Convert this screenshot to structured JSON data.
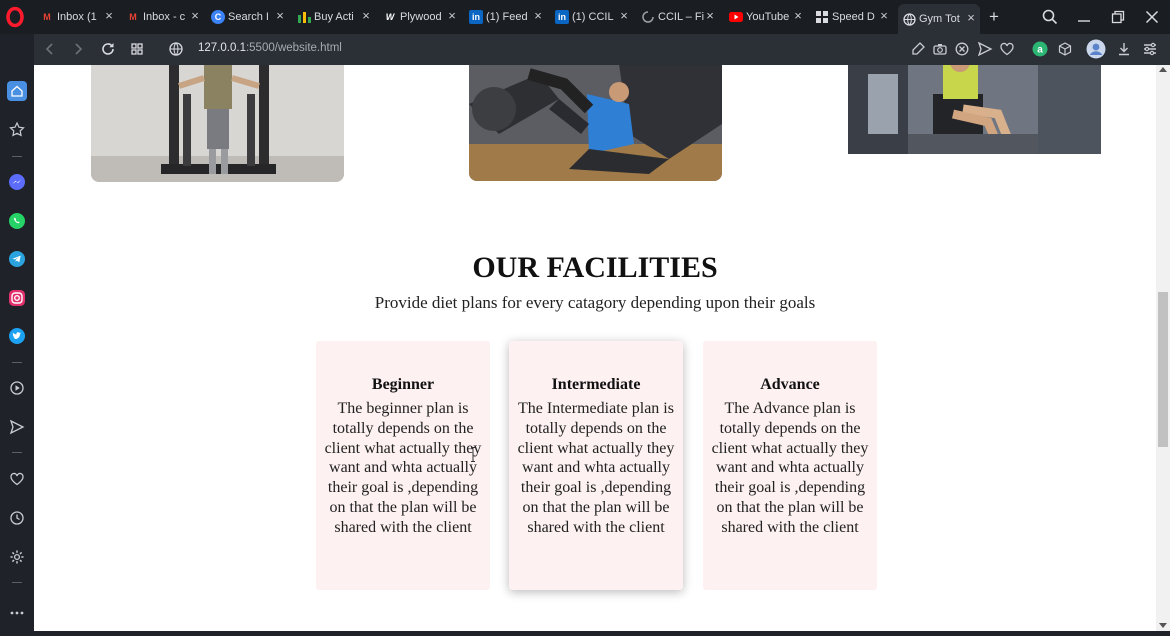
{
  "browser": {
    "tabs": [
      {
        "title": "Inbox (1",
        "icon": "gmail-icon"
      },
      {
        "title": "Inbox - c",
        "icon": "gmail-icon"
      },
      {
        "title": "Search I",
        "icon": "search-app-icon"
      },
      {
        "title": "Buy Acti",
        "icon": "bar-chart-icon"
      },
      {
        "title": "Plywood",
        "icon": "plywood-icon"
      },
      {
        "title": "(1) Feed",
        "icon": "linkedin-icon"
      },
      {
        "title": "(1) CCIL",
        "icon": "linkedin-icon"
      },
      {
        "title": "CCIL – Fi",
        "icon": "loading-icon"
      },
      {
        "title": "YouTube",
        "icon": "youtube-icon"
      },
      {
        "title": "Speed D",
        "icon": "speed-dial-icon"
      },
      {
        "title": "Gym Tot",
        "icon": "globe-icon"
      }
    ],
    "active_tab_index": 10,
    "address": {
      "host": "127.0.0.1",
      "path": ":5500/website.html"
    }
  },
  "facilities": {
    "title": "OUR FACILITIES",
    "subtitle": "Provide diet plans for every catagory depending upon their goals",
    "cards": [
      {
        "title": "Beginner",
        "text": "The beginner plan is totally depends on the client what actually they want and whta actually their goal is ,depending on that the plan will be shared with the client"
      },
      {
        "title": "Intermediate",
        "text": "The Intermediate plan is totally depends on the client what actually they want and whta actually their goal is ,depending on that the plan will be shared with the client"
      },
      {
        "title": "Advance",
        "text": "The Advance plan is totally depends on the client what actually they want and whta actually their goal is ,depending on that the plan will be shared with the client"
      }
    ]
  },
  "colors": {
    "card_bg": "#fdf1f1",
    "browser_dark": "#1a1d22",
    "opera_red": "#ff1b2d"
  }
}
